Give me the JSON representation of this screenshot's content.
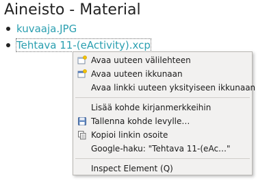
{
  "page": {
    "heading": "Aineisto - Material"
  },
  "files": [
    {
      "name": "kuvaaja.JPG"
    },
    {
      "name": "Tehtava 11-(eActivity).xcp"
    }
  ],
  "context_menu": {
    "items": [
      {
        "label": "Avaa uuteen välilehteen",
        "icon": "new-tab-icon"
      },
      {
        "label": "Avaa uuteen ikkunaan",
        "icon": "new-window-icon"
      },
      {
        "label": "Avaa linkki uuteen yksityiseen ikkunaan",
        "icon": ""
      },
      {
        "label": "Lisää kohde kirjanmerkkeihin",
        "icon": ""
      },
      {
        "label": "Tallenna kohde levylle…",
        "icon": "save-icon"
      },
      {
        "label": "Kopioi linkin osoite",
        "icon": "copy-icon"
      },
      {
        "label": "Google-haku: \"Tehtava 11-(eAc…\"",
        "icon": ""
      },
      {
        "label": "Inspect Element (Q)",
        "icon": ""
      }
    ]
  },
  "colors": {
    "link": "#2a9fb0",
    "menu_bg": "#f2f1f0"
  }
}
